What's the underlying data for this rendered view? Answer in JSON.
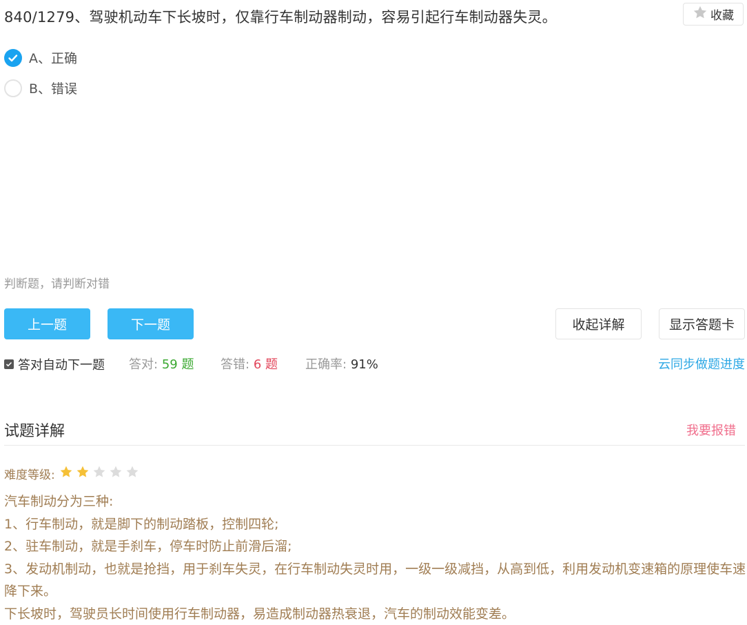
{
  "question": {
    "text": "840/1279、驾驶机动车下长坡时，仅靠行车制动器制动，容易引起行车制动器失灵。",
    "favorite_label": "收藏",
    "favorite_icon": "star-icon"
  },
  "options": [
    {
      "label": "A、正确",
      "selected": true
    },
    {
      "label": "B、错误",
      "selected": false
    }
  ],
  "hint": "判断题，请判断对错",
  "buttons": {
    "prev": "上一题",
    "next": "下一题",
    "collapse": "收起详解",
    "answer_card": "显示答题卡"
  },
  "auto_next": {
    "label": "答对自动下一题",
    "checked": true
  },
  "stats": {
    "right_label": "答对:",
    "right_value": "59 题",
    "wrong_label": "答错:",
    "wrong_value": "6 题",
    "rate_label": "正确率:",
    "rate_value": "91%"
  },
  "sync_link": "云同步做题进度",
  "details": {
    "title": "试题详解",
    "report_label": "我要报错",
    "difficulty_label": "难度等级:",
    "difficulty_stars": 2,
    "difficulty_max": 5,
    "lines": [
      "汽车制动分为三种:",
      "1、行车制动，就是脚下的制动踏板，控制四轮;",
      "2、驻车制动，就是手刹车，停车时防止前滑后溜;",
      "3、发动机制动，也就是抢挡，用于刹车失灵，在行车制动失灵时用，一级一级减挡，从高到低，利用发动机变速箱的原理使车速降下来。",
      "下长坡时，驾驶员长时间使用行车制动器，易造成制动器热衰退，汽车的制动效能变差。"
    ]
  },
  "colors": {
    "accent": "#3ab8f5",
    "check": "#1aa3f0",
    "right": "#3aa830",
    "wrong": "#e2455a",
    "link": "#2ea8e5",
    "report": "#f06e8c",
    "explanation": "#a07d53",
    "star_on": "#f5c037",
    "star_off": "#dcdcdc"
  }
}
